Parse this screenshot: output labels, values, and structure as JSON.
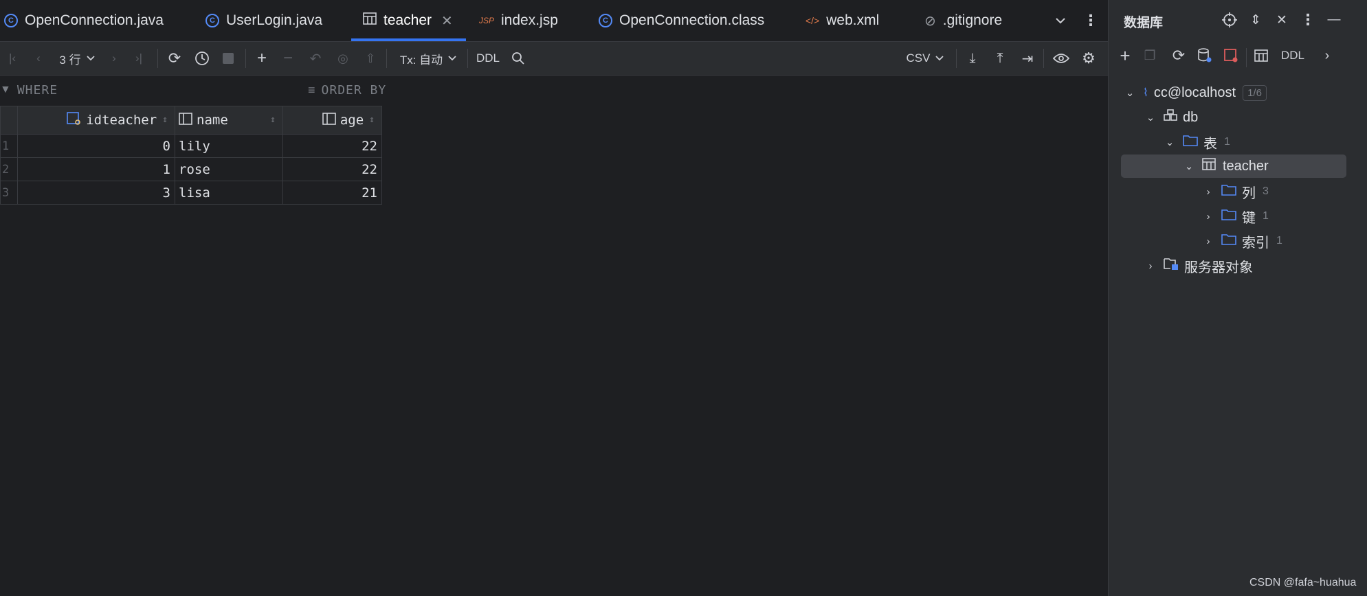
{
  "tabs": [
    {
      "label": "OpenConnection.java",
      "icon": "class-icon"
    },
    {
      "label": "UserLogin.java",
      "icon": "class-icon"
    },
    {
      "label": "teacher",
      "icon": "table-icon",
      "active": true
    },
    {
      "label": "index.jsp",
      "icon": "jsp-icon"
    },
    {
      "label": "OpenConnection.class",
      "icon": "class-icon"
    },
    {
      "label": "web.xml",
      "icon": "xml-icon"
    },
    {
      "label": ".gitignore",
      "icon": "ignore-icon"
    }
  ],
  "tab_icons": {
    "class": "©",
    "jsp": "JSP",
    "xml": "</>",
    "ignore": "⊘",
    "close": "✕"
  },
  "toolbar": {
    "rows": "3 行",
    "tx": "Tx: 自动",
    "ddl": "DDL",
    "export_format": "CSV"
  },
  "filter": {
    "where": "WHERE",
    "order_by": "ORDER BY"
  },
  "grid": {
    "columns": [
      "idteacher",
      "name",
      "age"
    ],
    "rows": [
      {
        "n": "1",
        "idteacher": "0",
        "name": "lily",
        "age": "22"
      },
      {
        "n": "2",
        "idteacher": "1",
        "name": "rose",
        "age": "22"
      },
      {
        "n": "3",
        "idteacher": "3",
        "name": "lisa",
        "age": "21"
      }
    ]
  },
  "database_panel": {
    "title": "数据库",
    "ddl": "DDL",
    "tree": {
      "connection": "cc@localhost",
      "connection_badge": "1/6",
      "schema": "db",
      "tables_folder": "表",
      "tables_count": "1",
      "table": "teacher",
      "columns_folder": "列",
      "columns_count": "3",
      "keys_folder": "键",
      "keys_count": "1",
      "indexes_folder": "索引",
      "indexes_count": "1",
      "server_objects": "服务器对象"
    }
  },
  "watermark": "CSDN @fafa~huahua",
  "colors": {
    "accent": "#3574f0",
    "background": "#1e1f22",
    "panel": "#2b2d30",
    "folder": "#548af7"
  }
}
